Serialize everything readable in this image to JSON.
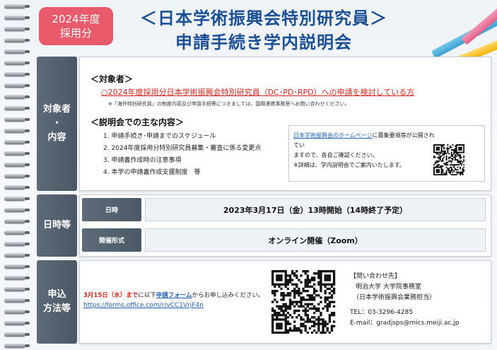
{
  "header": {
    "badge_line1": "2024年度",
    "badge_line2": "採用分",
    "title_line1": "＜日本学術振興会特別研究員＞",
    "title_line2": "申請手続き学内説明会"
  },
  "section_target": {
    "label_line1": "対象者",
    "label_line2": "・",
    "label_line3": "内容",
    "target_heading": "＜対象者＞",
    "target_text": "○2024年度採用分日本学術振興会特別研究員（DC･PD･RPD）への申請を検討している方",
    "target_note": "※「海外特別研究員」の制度内容及び申請手続等につきましては、国際連携事務室へお問い合わせください。",
    "content_heading": "＜説明会での主な内容＞",
    "items": [
      "1. 申請手続き･申請までのスケジュール",
      "2. 2024年度採用分特別研究員募集・審査に係る変更点",
      "3. 申請書作成時の注意事項",
      "4. 本学の申請書作成支援制度　等"
    ],
    "info_link": "日本学術振興会のホームページ",
    "info_text1": "に募集要項等が公開されてい",
    "info_text2": "ますので、各自ご確認ください。",
    "info_text3": "※詳細は、学内説明会でご案内いたします。"
  },
  "section_datetime": {
    "label": "日時等",
    "date_tab": "日時",
    "date_value": "2023年3月17日（金）13時開始（14時終了予定）",
    "format_tab": "開催形式",
    "format_value": "オンライン開催（Zoom）"
  },
  "section_apply": {
    "label_line1": "申込",
    "label_line2": "方法等",
    "deadline": "3月15日（水）まで",
    "apply_mid": "に以下",
    "form_link": "申請フォーム",
    "apply_tail": "からお申し込みください。",
    "url": "https://forms.office.com/r/vCC1VrjF4n",
    "contact_heading": "【問い合わせ先】",
    "contact_org1": "明治大学 大学院事務室",
    "contact_org2": "（日本学術振興会業務担当）",
    "contact_tel": "TEL：03-3296-4285",
    "contact_email": "E-mail：gradjsps@mics.meiji.ac.jp"
  },
  "colors": {
    "title_blue": "#1b4f95",
    "badge_red": "#e95a6a",
    "target_red": "#d9261c",
    "label_gray": "#4f5b69"
  }
}
